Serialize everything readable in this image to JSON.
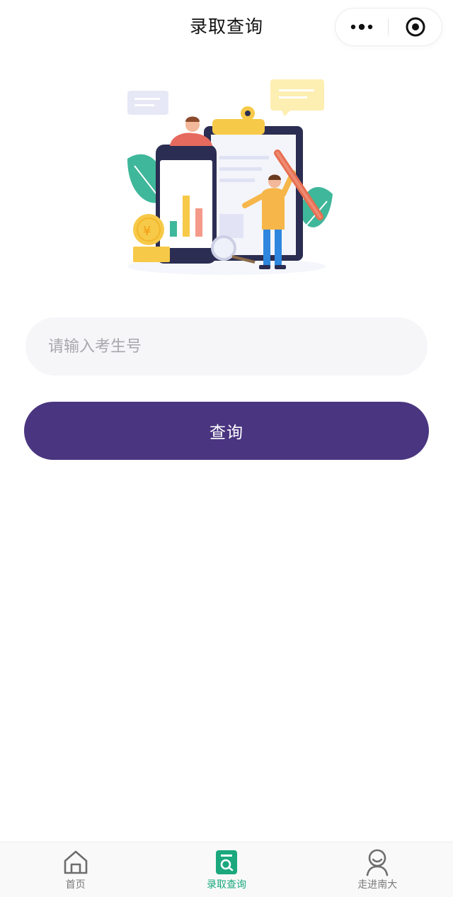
{
  "header": {
    "title": "录取查询",
    "more_icon": "more-dots-icon",
    "close_icon": "target-close-icon"
  },
  "illustration": {
    "icon": "admission-query-illustration"
  },
  "form": {
    "placeholder": "请输入考生号",
    "value": "",
    "submit_label": "查询"
  },
  "colors": {
    "primary": "#4a3580",
    "tab_active": "#1aa87c",
    "tab_inactive": "#7a7a7a",
    "input_bg": "#f6f6f9"
  },
  "tabbar": {
    "items": [
      {
        "label": "首页",
        "icon": "home-icon",
        "active": false
      },
      {
        "label": "录取查询",
        "icon": "query-icon",
        "active": true
      },
      {
        "label": "走进南大",
        "icon": "person-icon",
        "active": false
      }
    ]
  }
}
